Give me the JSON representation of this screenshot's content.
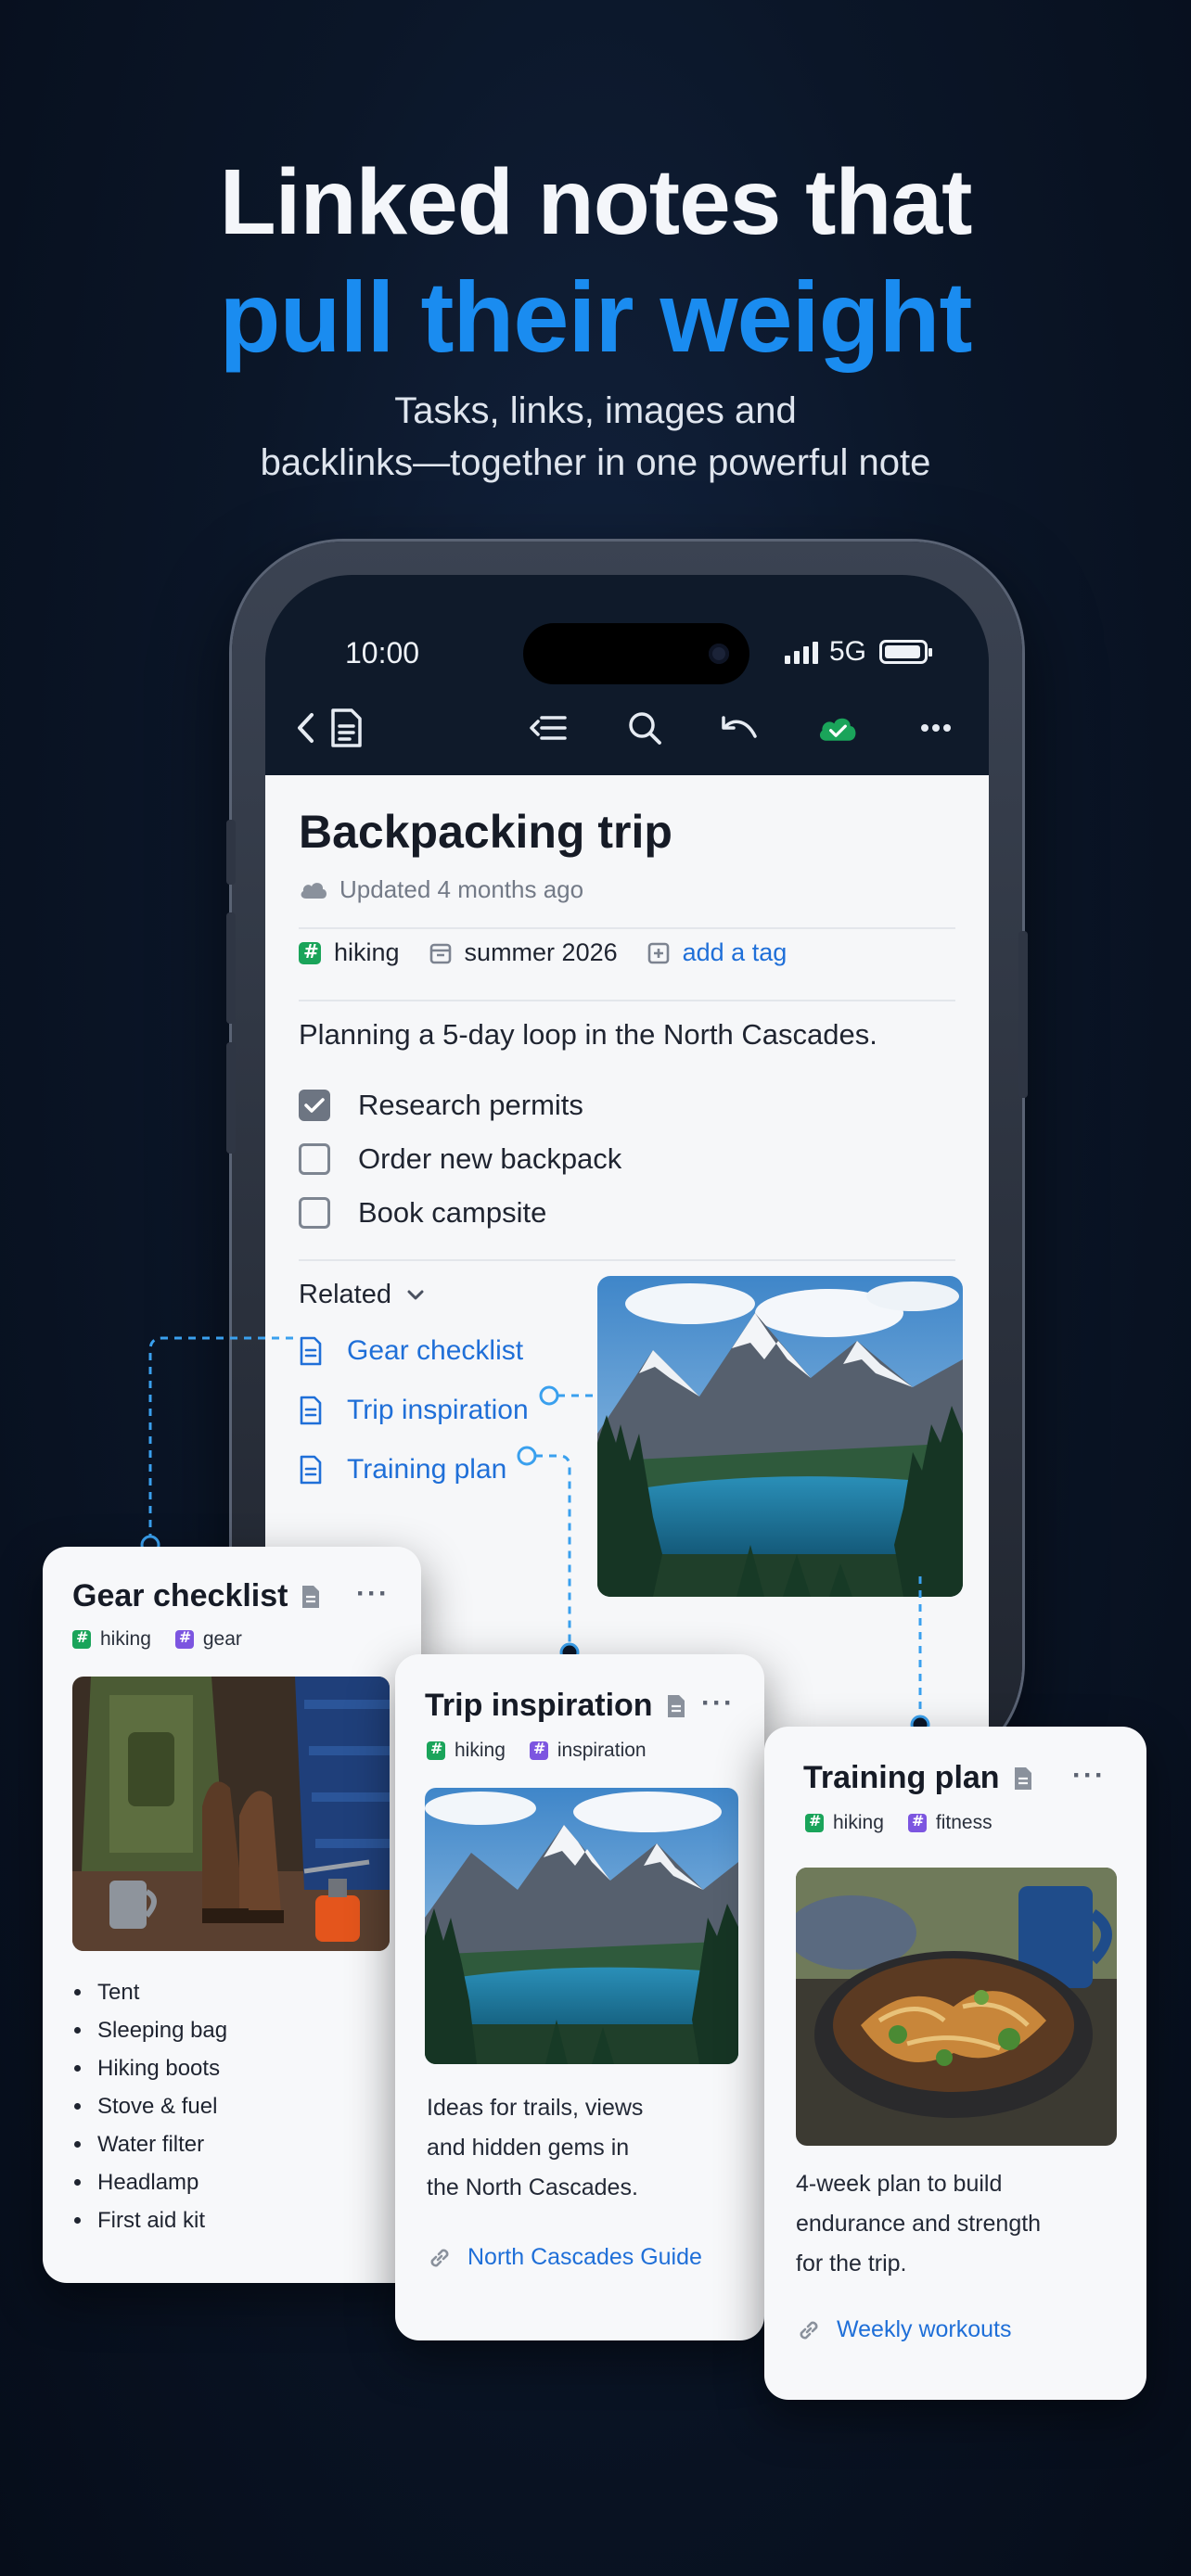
{
  "headline": {
    "line1": "Linked notes that",
    "line2": "pull their weight",
    "sub1": "Tasks, links, images and",
    "sub2": "backlinks—together in one powerful note"
  },
  "status_bar": {
    "time": "10:00",
    "network": "5G"
  },
  "toolbar": {
    "icons": [
      "back-icon",
      "note-icon",
      "outline-icon",
      "search-icon",
      "undo-icon",
      "cloud-sync-icon",
      "more-icon"
    ],
    "sync_color": "#1aa45a"
  },
  "note": {
    "title": "Backpacking trip",
    "updated": "Updated 4 months ago",
    "tags": [
      {
        "label": "hiking",
        "icon": "tag-icon",
        "color": "#1aa45a"
      },
      {
        "label": "summer 2026",
        "icon": "calendar-icon"
      },
      {
        "label": "add a tag",
        "icon": "add-tag-icon"
      }
    ],
    "body": "Planning a 5-day loop in the North Cascades.",
    "todos": [
      {
        "label": "Research permits",
        "checked": true
      },
      {
        "label": "Order new backpack",
        "checked": false
      },
      {
        "label": "Book campsite",
        "checked": false
      }
    ],
    "related_label": "Related",
    "related_links": [
      "Gear checklist",
      "Trip inspiration",
      "Training plan"
    ]
  },
  "cards": {
    "gear": {
      "title": "Gear checklist",
      "tags": [
        "hiking",
        "gear"
      ],
      "items": [
        "Tent",
        "Sleeping bag",
        "Hiking boots",
        "Stove & fuel",
        "Water filter",
        "Headlamp",
        "First aid kit"
      ]
    },
    "trip": {
      "title": "Trip inspiration",
      "tags": [
        "hiking",
        "inspiration"
      ],
      "desc1": "Ideas for trails, views",
      "desc2": "and hidden gems in",
      "desc3": "the North Cascades.",
      "link": "North Cascades Guide"
    },
    "training": {
      "title": "Training plan",
      "tags": [
        "hiking",
        "fitness"
      ],
      "desc1": "4-week plan to build",
      "desc2": "endurance and strength",
      "desc3": "for the trip.",
      "link": "Weekly workouts"
    }
  },
  "colors": {
    "accent": "#1a8cf0",
    "link": "#1f6fd8",
    "tag_green": "#1aa45a",
    "tag_purple": "#7c55e0"
  }
}
